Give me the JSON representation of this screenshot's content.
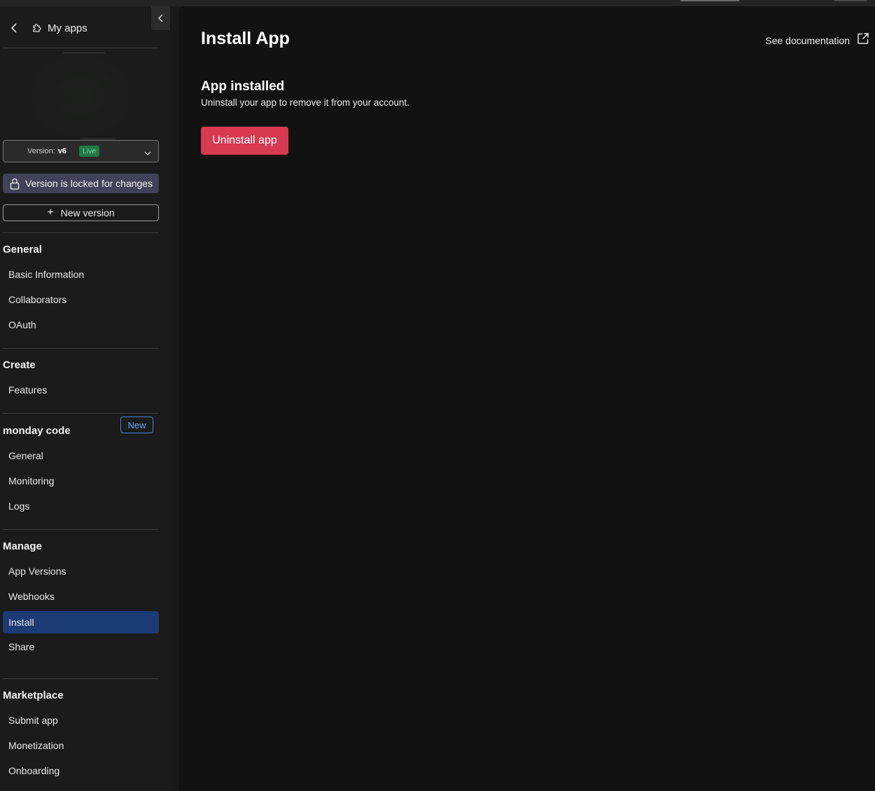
{
  "nav": {
    "back_label": "My apps"
  },
  "version": {
    "label": "Version:",
    "number": "v6",
    "status": "Live",
    "locked_message": "Version is locked for changes",
    "new_version_label": "New version"
  },
  "sidebar": {
    "general": {
      "title": "General",
      "items": [
        "Basic Information",
        "Collaborators",
        "OAuth"
      ]
    },
    "create": {
      "title": "Create",
      "items": [
        "Features"
      ]
    },
    "monday_code": {
      "title": "monday code",
      "badge": "New",
      "items": [
        "General",
        "Monitoring",
        "Logs"
      ]
    },
    "manage": {
      "title": "Manage",
      "items": [
        "App Versions",
        "Webhooks",
        "Install",
        "Share"
      ],
      "active": "Install"
    },
    "marketplace": {
      "title": "Marketplace",
      "items": [
        "Submit app",
        "Monetization",
        "Onboarding"
      ]
    }
  },
  "main": {
    "title": "Install App",
    "docs_link": "See documentation",
    "subtitle": "App installed",
    "description": "Uninstall your app to remove it from your account.",
    "uninstall_label": "Uninstall app"
  },
  "colors": {
    "danger": "#d83a52",
    "active_nav": "#1c3a73",
    "live_badge": "#1f7a47",
    "locked_banner": "#414158",
    "new_badge": "#3f83e6"
  },
  "icons": [
    "chevron-left-icon",
    "puzzle-icon",
    "chevron-down-icon",
    "lock-icon",
    "plus-icon",
    "external-link-icon"
  ]
}
